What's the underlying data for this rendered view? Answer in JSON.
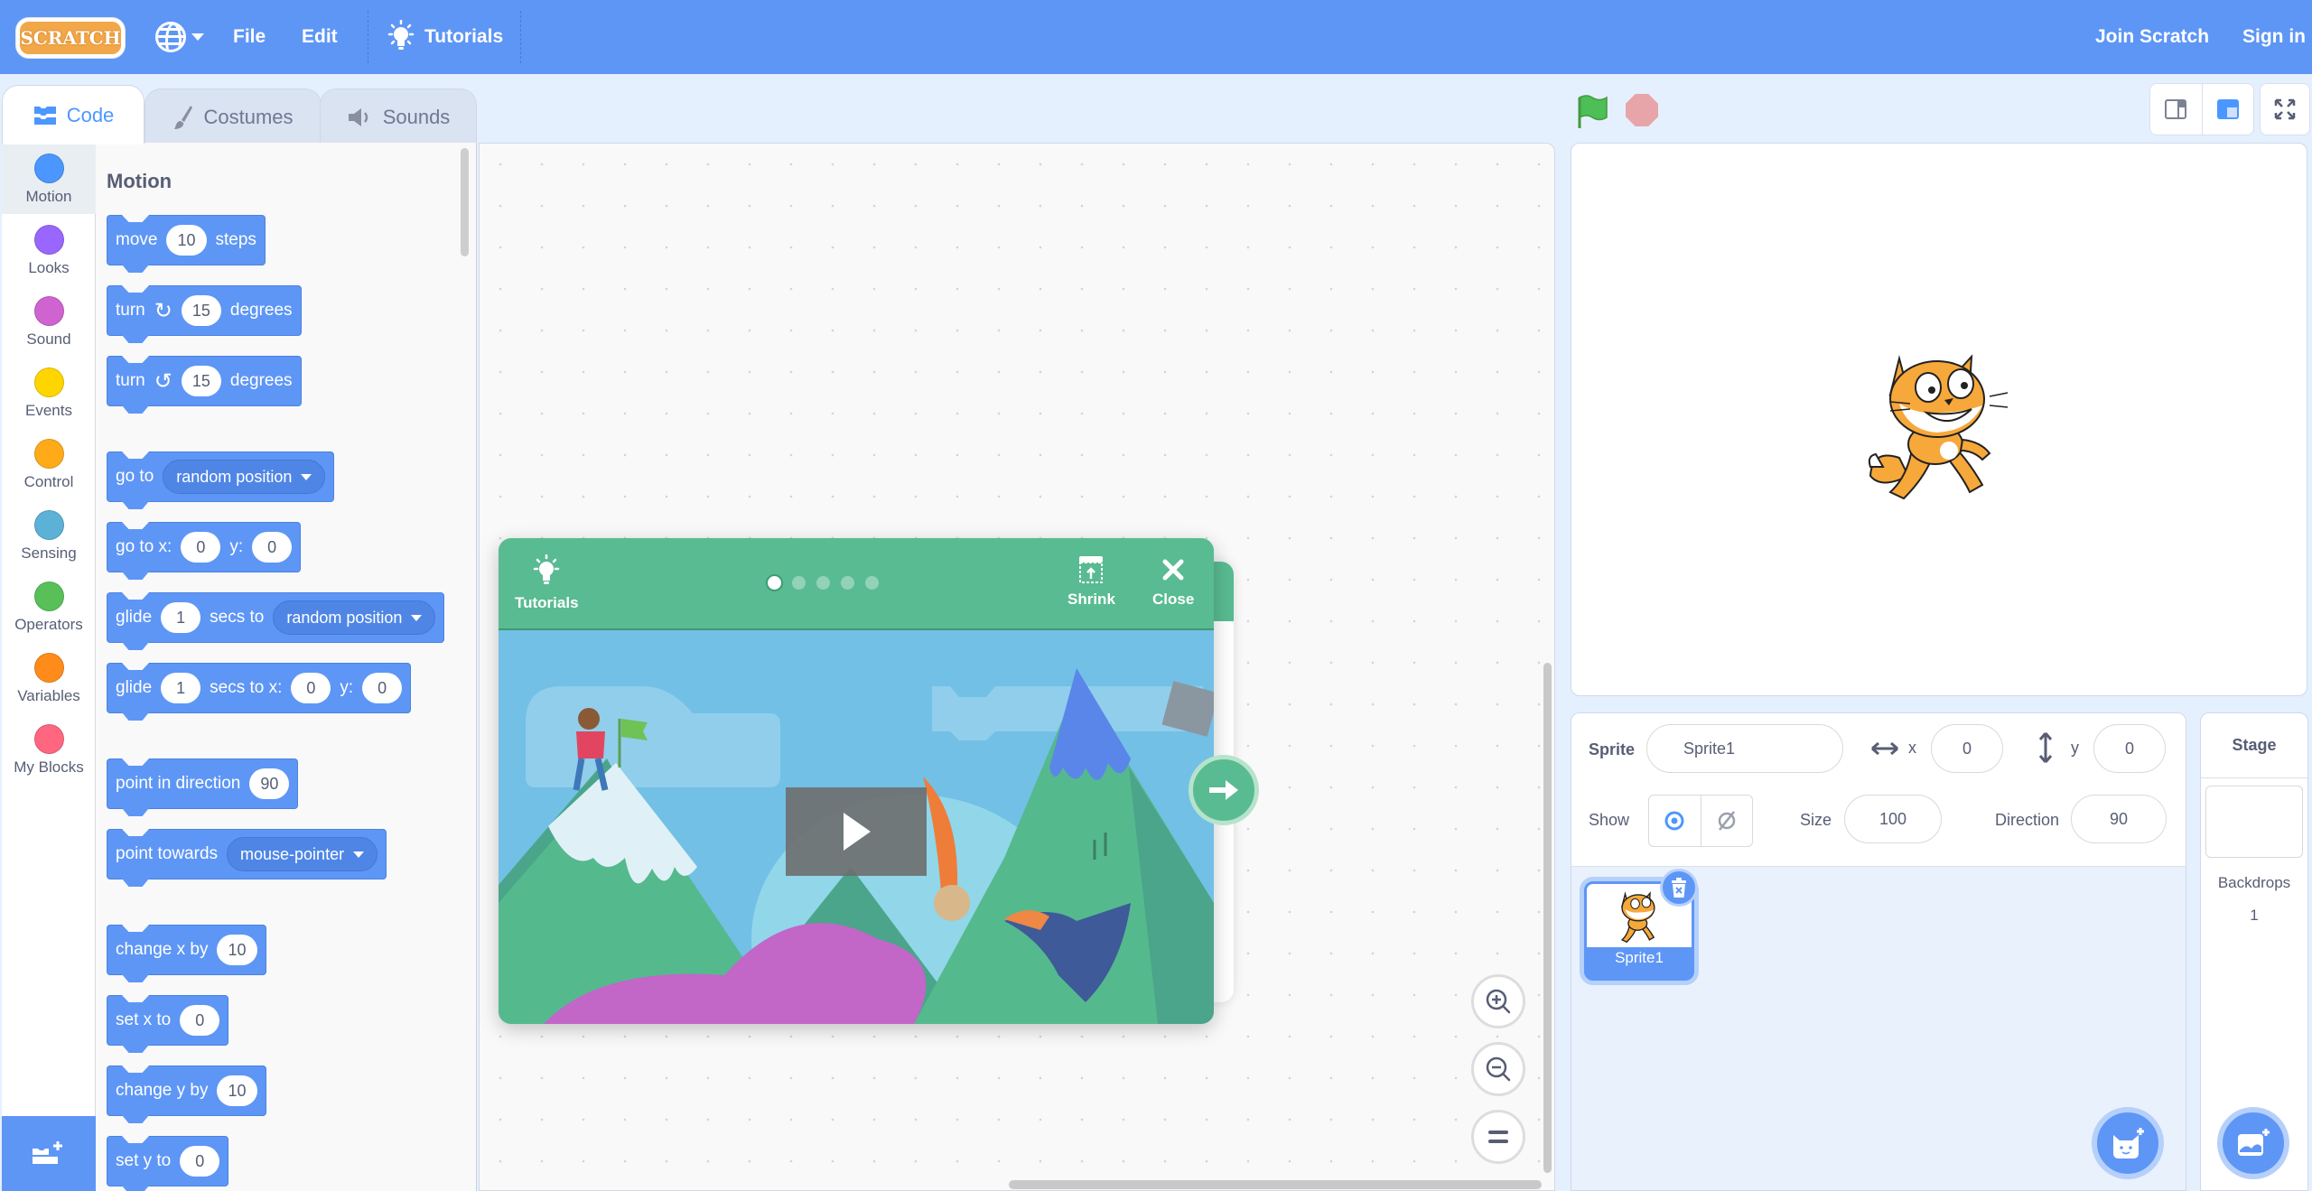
{
  "navbar": {
    "logo_text": "SCRATCH",
    "menu": [
      "File",
      "Edit"
    ],
    "tutorials": "Tutorials",
    "join": "Join Scratch",
    "signin": "Sign in"
  },
  "tabs": [
    {
      "label": "Code",
      "active": true,
      "icon": "code-icon"
    },
    {
      "label": "Costumes",
      "active": false,
      "icon": "brush-icon"
    },
    {
      "label": "Sounds",
      "active": false,
      "icon": "speaker-icon"
    }
  ],
  "categories": [
    {
      "label": "Motion",
      "color": "#4c97ff"
    },
    {
      "label": "Looks",
      "color": "#9966ff"
    },
    {
      "label": "Sound",
      "color": "#cf63cf"
    },
    {
      "label": "Events",
      "color": "#ffd500"
    },
    {
      "label": "Control",
      "color": "#ffab19"
    },
    {
      "label": "Sensing",
      "color": "#5cb1d6"
    },
    {
      "label": "Operators",
      "color": "#59c059"
    },
    {
      "label": "Variables",
      "color": "#ff8c1a"
    },
    {
      "label": "My Blocks",
      "color": "#ff6680"
    }
  ],
  "palette": {
    "title": "Motion",
    "blocks": {
      "move": {
        "t1": "move",
        "v1": "10",
        "t2": "steps"
      },
      "turn_right": {
        "t1": "turn",
        "v1": "15",
        "t2": "degrees"
      },
      "turn_left": {
        "t1": "turn",
        "v1": "15",
        "t2": "degrees"
      },
      "goto": {
        "t1": "go to",
        "d1": "random position"
      },
      "goto_xy": {
        "t1": "go to x:",
        "v1": "0",
        "t2": "y:",
        "v2": "0"
      },
      "glide_to": {
        "t1": "glide",
        "v1": "1",
        "t2": "secs to",
        "d1": "random position"
      },
      "glide_xy": {
        "t1": "glide",
        "v1": "1",
        "t2": "secs to x:",
        "v2": "0",
        "t3": "y:",
        "v3": "0"
      },
      "point_dir": {
        "t1": "point in direction",
        "v1": "90"
      },
      "point_towards": {
        "t1": "point towards",
        "d1": "mouse-pointer"
      },
      "change_x": {
        "t1": "change x by",
        "v1": "10"
      },
      "set_x": {
        "t1": "set x to",
        "v1": "0"
      },
      "change_y": {
        "t1": "change y by",
        "v1": "10"
      },
      "set_y": {
        "t1": "set y to",
        "v1": "0"
      }
    }
  },
  "tutorial_modal": {
    "tutorials_label": "Tutorials",
    "shrink_label": "Shrink",
    "close_label": "Close",
    "step_count": 5,
    "current_step": 1
  },
  "sprite_info": {
    "sprite_label": "Sprite",
    "sprite_name": "Sprite1",
    "x_label": "x",
    "x": "0",
    "y_label": "y",
    "y": "0",
    "show_label": "Show",
    "size_label": "Size",
    "size": "100",
    "direction_label": "Direction",
    "direction": "90"
  },
  "sprites": [
    {
      "name": "Sprite1",
      "selected": true
    }
  ],
  "stage_selector": {
    "title": "Stage",
    "backdrops_label": "Backdrops",
    "backdrops_count": "1"
  },
  "colors": {
    "accent": "#4c97ff",
    "tutorial_green": "#59bb91",
    "stop_red": "#e7a5a9",
    "flag_green": "#4cbf56"
  }
}
